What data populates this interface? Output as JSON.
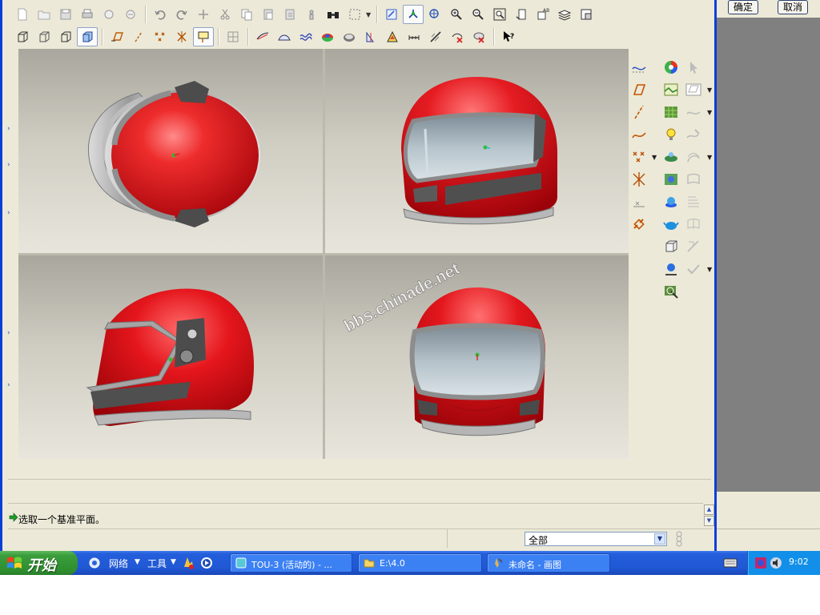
{
  "toolbar": {
    "row1": [
      "new-file-icon",
      "open-folder-icon",
      "save-icon",
      "print-icon",
      "send-icon",
      "mail-icon",
      "undo-icon",
      "redo-icon",
      "regenerate-icon",
      "cut-icon",
      "copy-icon",
      "paste-icon",
      "paste-special-icon",
      "tool-icon",
      "binoculars-icon",
      "select-box-icon",
      "repaint-icon",
      "spin-center-icon",
      "orient-icon",
      "zoom-in-icon",
      "zoom-out-icon",
      "zoom-fit-icon",
      "view-manager-icon",
      "named-views-icon",
      "layers-icon",
      "model-tree-icon"
    ],
    "row2": [
      "wireframe-icon",
      "hidden-line-icon",
      "no-hidden-icon",
      "shading-icon",
      "datum-plane-toggle-icon",
      "datum-axis-toggle-icon",
      "datum-point-toggle-icon",
      "csys-toggle-icon",
      "annotation-toggle-icon",
      "grid-icon",
      "analysis-1-icon",
      "analysis-2-icon",
      "curvature-icon",
      "reflection-icon",
      "draft-icon",
      "section-icon",
      "slope-icon",
      "measure-icon",
      "offset-icon",
      "delete-analysis-icon",
      "hide-analysis-icon",
      "context-help-icon"
    ]
  },
  "palette": {
    "col1": [
      "datum-curve-icon",
      "datum-plane-icon",
      "datum-axis-icon",
      "sketch-curve-icon",
      "datum-point-icon",
      "csys-icon",
      "ruler-icon",
      "link-icon"
    ],
    "col2": [
      "appearance-icon",
      "scene-icon",
      "texture-icon",
      "light-icon",
      "perspective-icon",
      "environment-icon",
      "model-icon",
      "teapot-icon",
      "box-icon",
      "snapshot-icon",
      "render-settings-icon"
    ],
    "col3": [
      "select-arrow-icon",
      "style-surface-icon",
      "style-curve-icon",
      "style-edit-icon",
      "boundary-icon",
      "blend-icon",
      "sweep-icon",
      "variable-icon",
      "trim-icon",
      "check-icon"
    ]
  },
  "views": {
    "watermark": "bbs.chinade.net"
  },
  "message": {
    "prompt": "选取一个基准平面。"
  },
  "status": {
    "filter_value": "全部"
  },
  "dialog": {
    "ok_label": "确定",
    "cancel_label": "取消"
  },
  "taskbar": {
    "start_label": "开始",
    "network_label": "网络",
    "tools_label": "工具",
    "tasks": [
      {
        "label": "TOU-3 (活动的) - ..."
      },
      {
        "label": "E:\\4.0"
      },
      {
        "label": "未命名 - 画图"
      }
    ],
    "clock": "9:02"
  },
  "colors": {
    "helmet_red": "#d4151c",
    "visor": "#a9b7c0",
    "xp_blue": "#245edb",
    "window_face": "#ece9d8"
  }
}
